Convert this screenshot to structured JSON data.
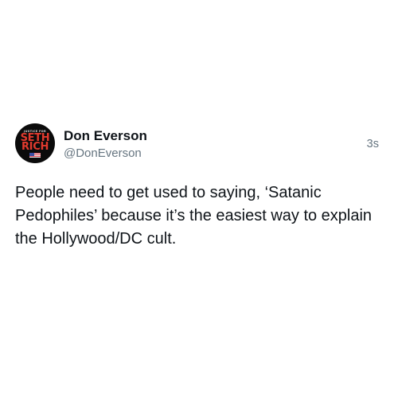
{
  "post": {
    "author": {
      "display_name": "Don Everson",
      "handle": "@DonEverson",
      "avatar": {
        "top_text": "JUSTICE FOR",
        "line1": "SETH",
        "line2": "RICH"
      }
    },
    "timestamp": "3s",
    "text": "People need to get used to saying, ‘Satanic Pedophiles’ because it’s the easiest way to explain the Hollywood/DC cult."
  },
  "colors": {
    "text_primary": "#0f1419",
    "text_secondary": "#667580",
    "avatar_background": "#0b0b0b",
    "avatar_accent": "#e23a2e"
  }
}
